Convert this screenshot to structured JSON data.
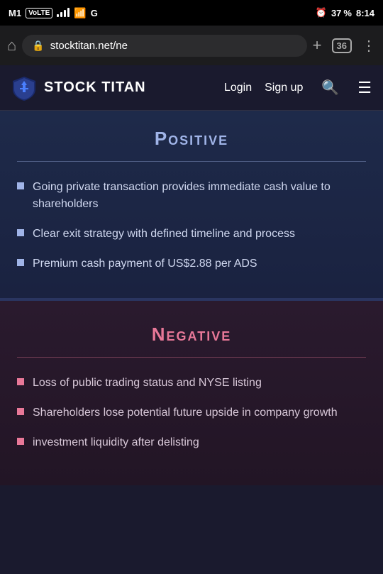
{
  "statusBar": {
    "carrier": "M1",
    "carrierTag": "VoLTE",
    "time": "8:14",
    "batteryPercent": "37"
  },
  "browserBar": {
    "url": "stocktitan.net/ne",
    "tabCount": "36"
  },
  "nav": {
    "logoText": "STOCK TITAN",
    "loginLabel": "Login",
    "signupLabel": "Sign up"
  },
  "positive": {
    "title": "Positive",
    "bullets": [
      "Going private transaction provides immediate cash value to shareholders",
      "Clear exit strategy with defined timeline and process",
      "Premium cash payment of US$2.88 per ADS"
    ]
  },
  "negative": {
    "title": "Negative",
    "bullets": [
      "Loss of public trading status and NYSE listing",
      "Shareholders lose potential future upside in company growth",
      "investment liquidity after delisting"
    ]
  }
}
